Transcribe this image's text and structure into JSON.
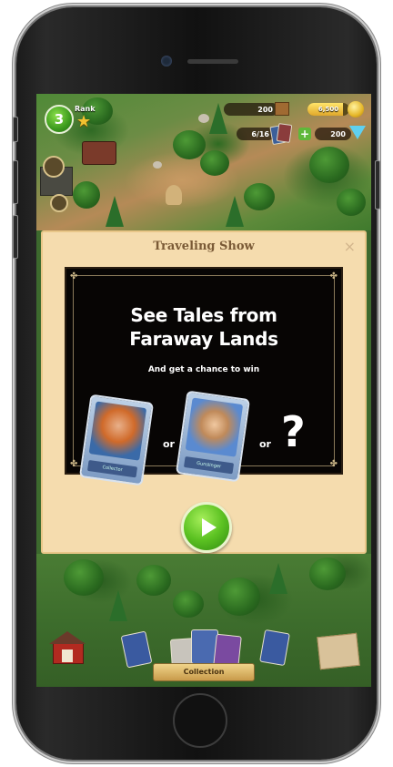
{
  "hud": {
    "level": "3",
    "rank_label": "Rank",
    "crates_count": "200",
    "coins_value": "6,500",
    "coins_progress": 0.85,
    "cards_count": "6/16",
    "gems_count": "200"
  },
  "dialog": {
    "title": "Traveling Show",
    "close_symbol": "×",
    "headline": "See Tales from Faraway Lands",
    "subtitle": "And get a chance to win",
    "prizes": [
      {
        "name": "Collector"
      },
      {
        "name": "Gunslinger"
      }
    ],
    "or_label": "or",
    "mystery_symbol": "?"
  },
  "toolbar": {
    "collection_label": "Collection"
  },
  "colors": {
    "dialog_bg": "#f5dcae",
    "title_text": "#7a5a36",
    "play_green": "#5cc222",
    "banner_bg": "#070504"
  },
  "icons": [
    "star-icon",
    "crate-icon",
    "coin-icon",
    "cards-icon",
    "plus-icon",
    "gem-icon",
    "close-icon",
    "play-icon",
    "barn-icon",
    "map-icon"
  ]
}
